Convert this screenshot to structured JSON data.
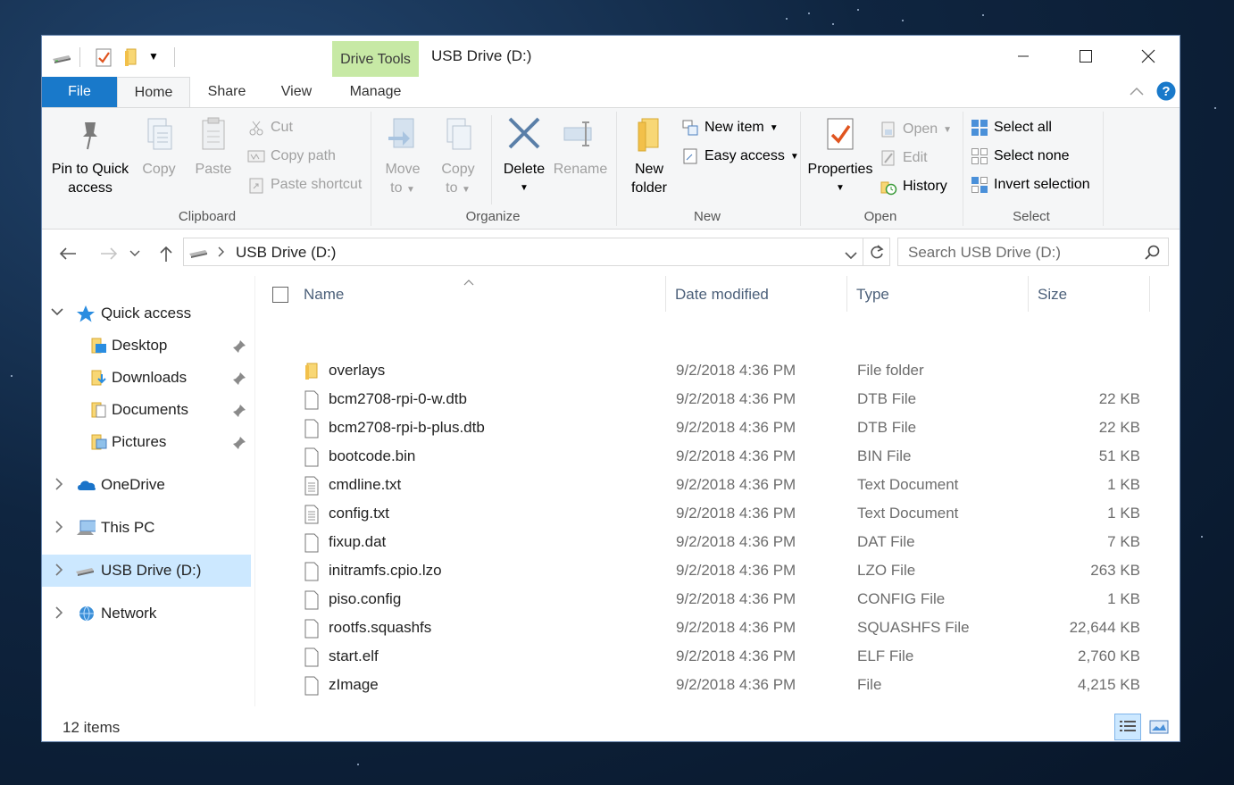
{
  "window": {
    "title": "USB Drive (D:)",
    "context_tab_group": "Drive Tools"
  },
  "tabs": {
    "file": "File",
    "home": "Home",
    "share": "Share",
    "view": "View",
    "manage": "Manage"
  },
  "ribbon": {
    "clipboard": {
      "label": "Clipboard",
      "pin_line1": "Pin to Quick",
      "pin_line2": "access",
      "copy": "Copy",
      "paste": "Paste",
      "cut": "Cut",
      "copy_path": "Copy path",
      "paste_shortcut": "Paste shortcut"
    },
    "organize": {
      "label": "Organize",
      "move_line1": "Move",
      "move_line2": "to",
      "copy_line1": "Copy",
      "copy_line2": "to",
      "delete": "Delete",
      "rename": "Rename"
    },
    "new": {
      "label": "New",
      "new_folder_line1": "New",
      "new_folder_line2": "folder",
      "new_item": "New item",
      "easy_access": "Easy access"
    },
    "open": {
      "label": "Open",
      "properties": "Properties",
      "open": "Open",
      "edit": "Edit",
      "history": "History"
    },
    "select": {
      "label": "Select",
      "select_all": "Select all",
      "select_none": "Select none",
      "invert_selection": "Invert selection"
    }
  },
  "address": {
    "path": "USB Drive (D:)",
    "search_placeholder": "Search USB Drive (D:)"
  },
  "nav": {
    "quick_access": "Quick access",
    "desktop": "Desktop",
    "downloads": "Downloads",
    "documents": "Documents",
    "pictures": "Pictures",
    "onedrive": "OneDrive",
    "this_pc": "This PC",
    "usb_drive": "USB Drive (D:)",
    "network": "Network"
  },
  "columns": {
    "name": "Name",
    "date": "Date modified",
    "type": "Type",
    "size": "Size"
  },
  "files": [
    {
      "name": "overlays",
      "date": "9/2/2018 4:36 PM",
      "type": "File folder",
      "size": ""
    },
    {
      "name": "bcm2708-rpi-0-w.dtb",
      "date": "9/2/2018 4:36 PM",
      "type": "DTB File",
      "size": "22 KB"
    },
    {
      "name": "bcm2708-rpi-b-plus.dtb",
      "date": "9/2/2018 4:36 PM",
      "type": "DTB File",
      "size": "22 KB"
    },
    {
      "name": "bootcode.bin",
      "date": "9/2/2018 4:36 PM",
      "type": "BIN File",
      "size": "51 KB"
    },
    {
      "name": "cmdline.txt",
      "date": "9/2/2018 4:36 PM",
      "type": "Text Document",
      "size": "1 KB"
    },
    {
      "name": "config.txt",
      "date": "9/2/2018 4:36 PM",
      "type": "Text Document",
      "size": "1 KB"
    },
    {
      "name": "fixup.dat",
      "date": "9/2/2018 4:36 PM",
      "type": "DAT File",
      "size": "7 KB"
    },
    {
      "name": "initramfs.cpio.lzo",
      "date": "9/2/2018 4:36 PM",
      "type": "LZO File",
      "size": "263 KB"
    },
    {
      "name": "piso.config",
      "date": "9/2/2018 4:36 PM",
      "type": "CONFIG File",
      "size": "1 KB"
    },
    {
      "name": "rootfs.squashfs",
      "date": "9/2/2018 4:36 PM",
      "type": "SQUASHFS File",
      "size": "22,644 KB"
    },
    {
      "name": "start.elf",
      "date": "9/2/2018 4:36 PM",
      "type": "ELF File",
      "size": "2,760 KB"
    },
    {
      "name": "zImage",
      "date": "9/2/2018 4:36 PM",
      "type": "File",
      "size": "4,215 KB"
    }
  ],
  "status": {
    "item_count": "12 items"
  },
  "colors": {
    "accent": "#1979ca",
    "context_tab": "#c7e9a5",
    "selection": "#cce8ff",
    "folder": "#f8d775"
  }
}
